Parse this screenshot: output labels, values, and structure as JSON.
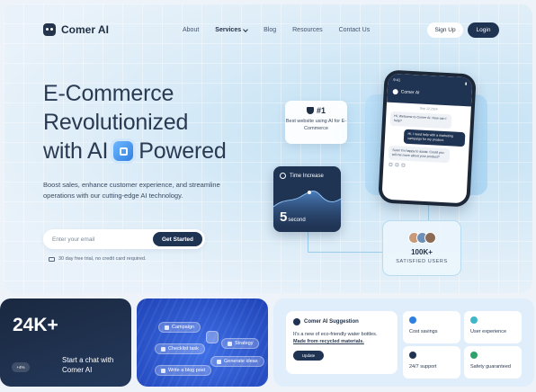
{
  "brand": {
    "name": "Comer AI"
  },
  "nav": {
    "items": [
      "About",
      "Services",
      "Blog",
      "Resources",
      "Contact Us"
    ],
    "signup_label": "Sign Up",
    "login_label": "Login"
  },
  "hero": {
    "headline_line1": "E-Commerce",
    "headline_line2": "Revolutionized",
    "headline_line3_pre": "with AI",
    "headline_line3_post": "Powered",
    "subtitle": "Boost sales, enhance customer experience, and streamline operations with our cutting-edge AI technology.",
    "email_placeholder": "Enter your email",
    "cta_label": "Get Started",
    "trial_note": "30 day free trial, no credit card required."
  },
  "rank_card": {
    "rank": "#1",
    "text": "Best website using AI for E-Commerce"
  },
  "time_card": {
    "title": "Time Increase",
    "value": "5",
    "unit": "second"
  },
  "users_card": {
    "count": "100K+",
    "label": "SATISFIED USERS"
  },
  "phone": {
    "time": "9:41",
    "title": "Comer AI",
    "date": "Sep 12,2024",
    "messages": [
      {
        "role": "bot",
        "text": "Hi, Welcome to Comer AI. How can I help?"
      },
      {
        "role": "user",
        "text": "Hi, I need help with a marketing campaign for my product."
      },
      {
        "role": "bot",
        "text": "Sure! I'm happy to assist. Could you tell me more about your product?"
      }
    ]
  },
  "stat_card": {
    "value": "24K+",
    "chip": "+4%",
    "text_line1": "Start a chat with",
    "text_line2": "Comer AI"
  },
  "tags": [
    "Campaign",
    "Checklist task",
    "Strategy",
    "Generate ideas",
    "Write a blog post"
  ],
  "suggestion": {
    "title": "Comer AI Suggestion",
    "text": "It's a new of eco-friendly water bottles.",
    "bold": "Made from recycled materials.",
    "button": "Update"
  },
  "features": [
    {
      "label": "Cost savings",
      "color": "#2f7fe0"
    },
    {
      "label": "User experience",
      "color": "#3fb6c9"
    },
    {
      "label": "24/7 support",
      "color": "#1f3352"
    },
    {
      "label": "Safety guaranteed",
      "color": "#2ba36b"
    }
  ]
}
